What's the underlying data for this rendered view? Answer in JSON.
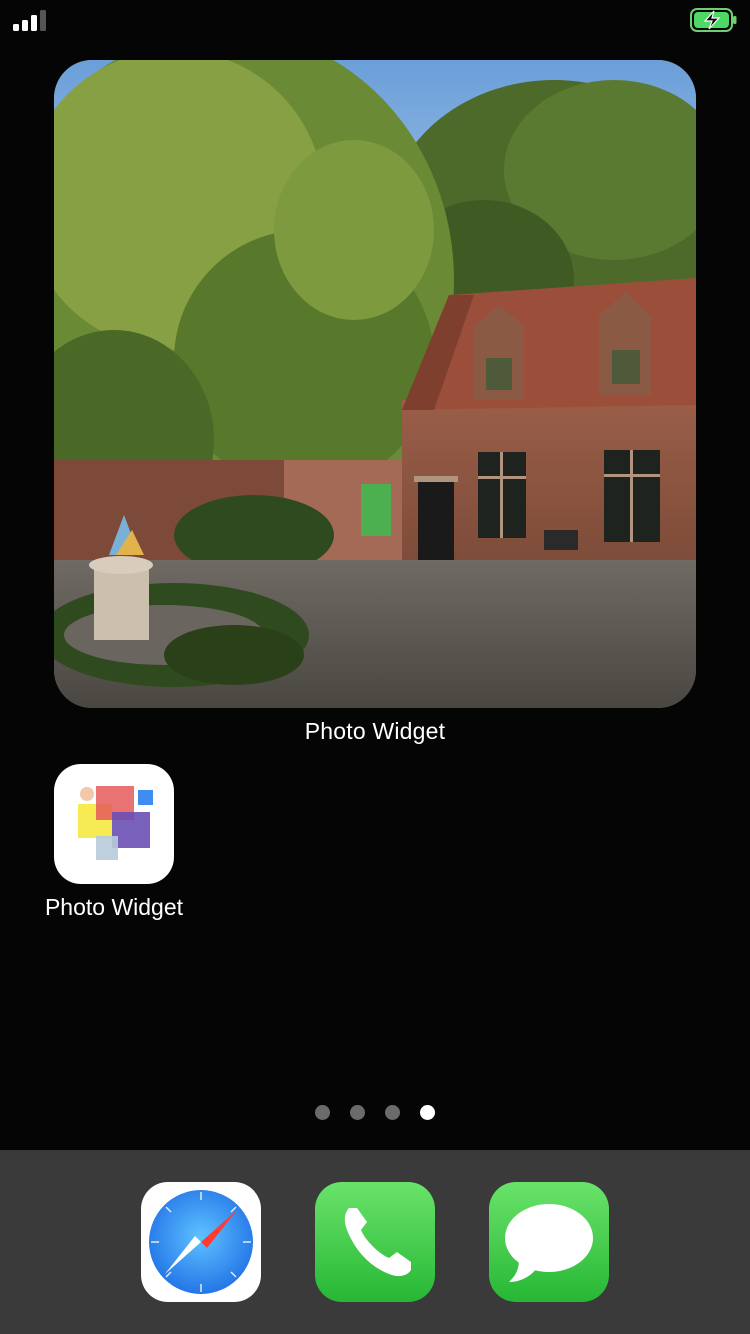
{
  "widget": {
    "label": "Photo Widget",
    "photo": "brick-house-courtyard-photo"
  },
  "apps": [
    {
      "label": "Photo Widget",
      "icon": "photo-widget-app-icon"
    }
  ],
  "page_indicator": {
    "count": 4,
    "active_index": 3
  },
  "dock": [
    {
      "name": "Safari",
      "icon": "compass-icon"
    },
    {
      "name": "Phone",
      "icon": "phone-handset-icon"
    },
    {
      "name": "Messages",
      "icon": "speech-bubble-icon"
    }
  ],
  "status": {
    "signal_icon": "cellular-signal-icon",
    "battery_icon": "battery-charging-icon",
    "battery_color": "#4cd964",
    "signal_bars_active": 3
  }
}
